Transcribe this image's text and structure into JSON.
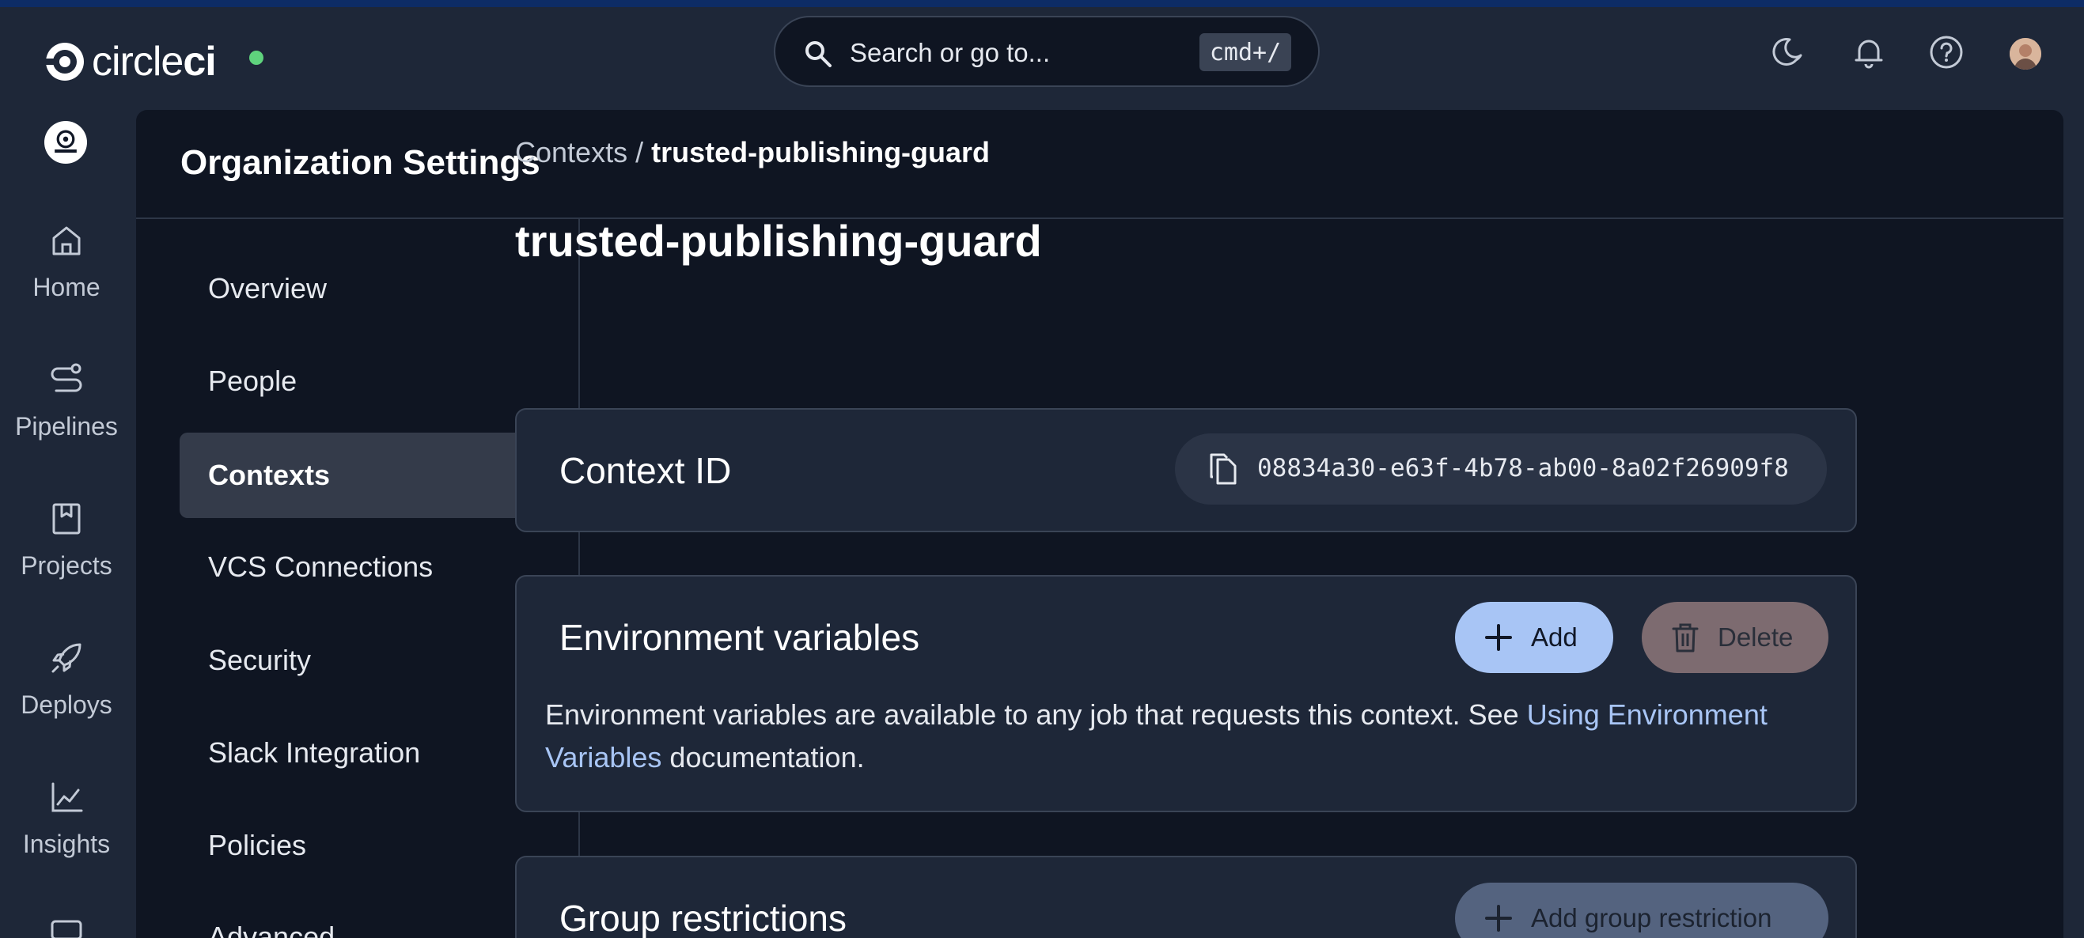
{
  "brand": {
    "name_light": "circle",
    "name_bold": "ci"
  },
  "search": {
    "placeholder": "Search or go to...",
    "shortcut": "cmd+/"
  },
  "rail": {
    "items": [
      {
        "label": "Home"
      },
      {
        "label": "Pipelines"
      },
      {
        "label": "Projects"
      },
      {
        "label": "Deploys"
      },
      {
        "label": "Insights"
      }
    ]
  },
  "panel": {
    "title": "Organization Settings"
  },
  "subnav": {
    "items": [
      {
        "label": "Overview"
      },
      {
        "label": "People"
      },
      {
        "label": "Contexts"
      },
      {
        "label": "VCS Connections"
      },
      {
        "label": "Security"
      },
      {
        "label": "Slack Integration"
      },
      {
        "label": "Policies"
      },
      {
        "label": "Advanced"
      }
    ],
    "active": "Contexts"
  },
  "breadcrumb": {
    "parent": "Contexts",
    "separator": " / ",
    "current": "trusted-publishing-guard"
  },
  "page": {
    "title": "trusted-publishing-guard"
  },
  "context_id": {
    "label": "Context ID",
    "value": "08834a30-e63f-4b78-ab00-8a02f26909f8"
  },
  "env_vars": {
    "title": "Environment variables",
    "add_label": "Add",
    "delete_label": "Delete",
    "desc_before": "Environment variables are available to any job that requests this context. See ",
    "desc_link": "Using Environment Variables",
    "desc_after": " documentation."
  },
  "groups": {
    "title": "Group restrictions",
    "add_label": "Add group restriction"
  },
  "colors": {
    "background": "#1e2738",
    "panel": "#0f1522",
    "accent": "#a8c5f5",
    "status_online": "#5fd37d",
    "danger_muted": "#7d6b70"
  }
}
